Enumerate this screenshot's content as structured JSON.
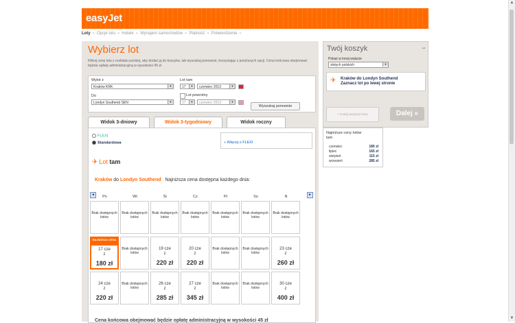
{
  "header": {
    "logo": "easyJet"
  },
  "breadcrumbs": [
    {
      "label": "Loty",
      "current": true
    },
    {
      "label": "Opcje lotu"
    },
    {
      "label": "Hotele"
    },
    {
      "label": "Wynajem samochodów"
    },
    {
      "label": "Płatność"
    },
    {
      "label": "Potwierdzenie"
    }
  ],
  "breadcrumb_separator": "»",
  "main": {
    "title": "Wybierz lot",
    "intro": "Kliknij cenę lotu z rozkładu poniżej, aby dodać ją do koszyka, lub wyszukaj ponownie, korzystając z poniższych opcji. Cena końcowa obejmować będzie opłatę administracyjną w wysokości 45 zł"
  },
  "search": {
    "from_label": "Wylot z",
    "from_value": "Kraków KRK",
    "to_label": "Do",
    "to_value": "Londyn Southend SEN",
    "out_label": "Lot tam",
    "out_day": "17",
    "out_month": "czerwiec 2013",
    "return_label": "Lot powrotny",
    "ret_day": "17",
    "ret_month": "czerwiec 2013",
    "search_button": "Wyszukaj ponownie"
  },
  "tabs": [
    {
      "label": "Widok 3-dniowy",
      "active": false
    },
    {
      "label": "Widok 3-tygodniowy",
      "active": true
    },
    {
      "label": "Widok roczny",
      "active": false
    }
  ],
  "fares": {
    "flexi": "FLEXI",
    "standard": "Standardowa",
    "more_link": "» Więcej o FLEXI"
  },
  "outbound": {
    "title_prefix": "Lot",
    "title_bold": "tam",
    "route_from": "Kraków",
    "route_mid": "do",
    "route_to": "Londyn Southend",
    "route_desc": "Najniższa cena dostępna każdego dnia:",
    "prev": "◄",
    "next": "►"
  },
  "weekdays": [
    "Pn",
    "Wt",
    "Śr",
    "Cz",
    "Pt",
    "So",
    "N"
  ],
  "calendar": [
    [
      {
        "na": "Brak dostępnych lotów"
      },
      {
        "na": "Brak dostępnych lotów"
      },
      {
        "na": "Brak dostępnych lotów"
      },
      {
        "na": "Brak dostępnych lotów"
      },
      {
        "na": "Brak dostępnych lotów"
      },
      {
        "na": "Brak dostępnych lotów"
      },
      {
        "na": "Brak dostępnych lotów"
      }
    ],
    [
      {
        "date": "17 cze",
        "from": "z",
        "price": "180 zł",
        "badge": "NAJNIŻSZA CENA"
      },
      {
        "na": "Brak dostępnych lotów"
      },
      {
        "date": "19 cze",
        "from": "z",
        "price": "220 zł"
      },
      {
        "date": "20 cze",
        "from": "z",
        "price": "220 zł"
      },
      {
        "na": "Brak dostępnych lotów"
      },
      {
        "na": "Brak dostępnych lotów"
      },
      {
        "date": "23 cze",
        "from": "z",
        "price": "260 zł"
      }
    ],
    [
      {
        "date": "24 cze",
        "from": "z",
        "price": "220 zł"
      },
      {
        "na": "Brak dostępnych lotów"
      },
      {
        "date": "26 cze",
        "from": "z",
        "price": "285 zł"
      },
      {
        "date": "27 cze",
        "from": "z",
        "price": "345 zł"
      },
      {
        "na": "Brak dostępnych lotów"
      },
      {
        "na": "Brak dostępnych lotów"
      },
      {
        "date": "30 cze",
        "from": "z",
        "price": "400 zł"
      }
    ]
  ],
  "footnote": "Cena końcowa obejmować będzie opłatę administracyjną w wysokości 45 zł",
  "basket": {
    "title": "Twój koszyk",
    "currency_label": "Pokaż w innej walucie",
    "currency_value": "złotych polskich",
    "flight_line1": "Kraków do Londyn Southend",
    "flight_line2": "Zaznacz lot po lewej stronie",
    "add_button": "Dodaj wiejszej lotów",
    "next_button": "Dalej »"
  },
  "lowest": {
    "title": "Najniższe ceny lotów",
    "subtitle": "tam",
    "rows": [
      {
        "month": "czerwiec",
        "price": "180 zł"
      },
      {
        "month": "lipiec",
        "price": "165 zł"
      },
      {
        "month": "sierpień",
        "price": "115 zł"
      },
      {
        "month": "wrzesień",
        "price": "285 zł"
      }
    ]
  },
  "colors": {
    "brand": "#ff6600",
    "link": "#0066cc"
  }
}
